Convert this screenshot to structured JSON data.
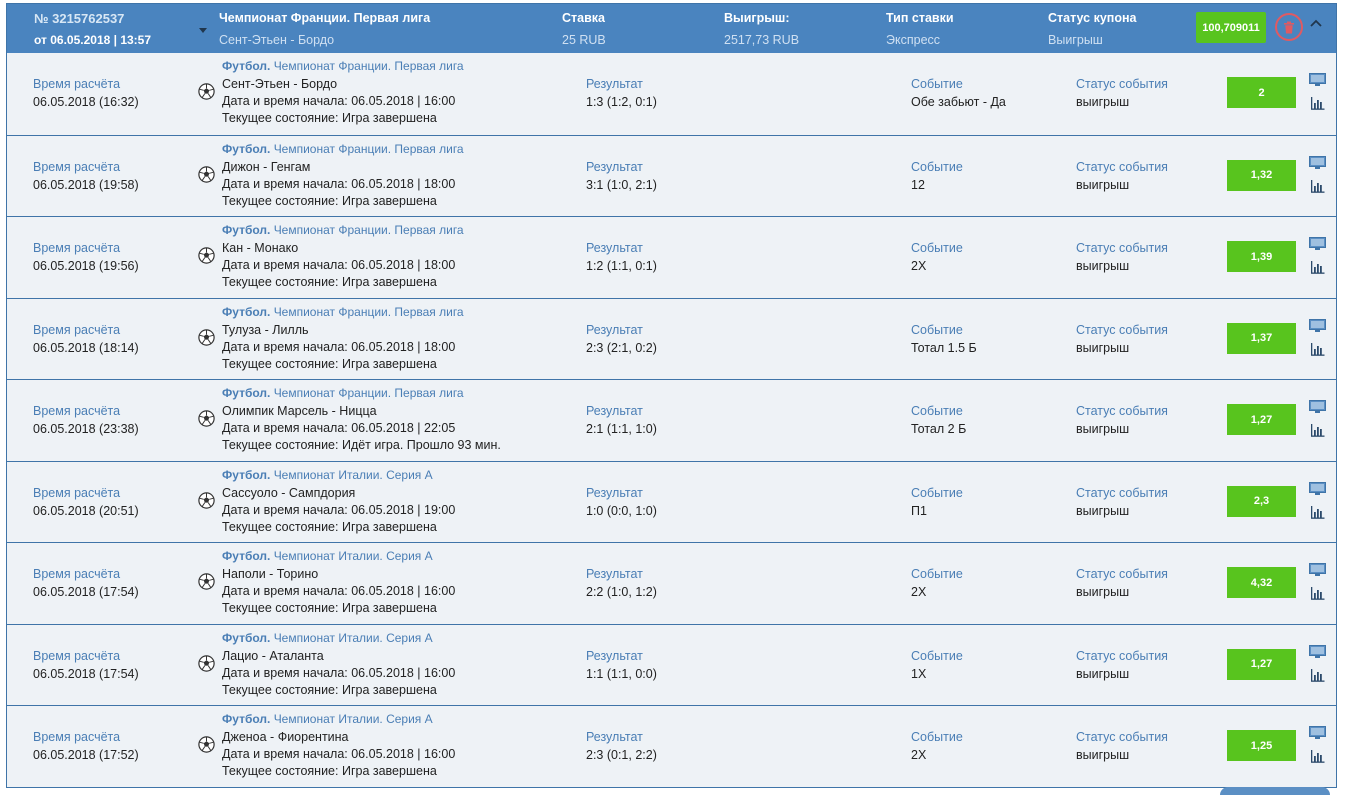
{
  "coupon": {
    "number": "№ 3215762537",
    "date": "от 06.05.2018 | 13:57",
    "championship": "Чемпионат Франции. Первая лига",
    "match": "Сент-Этьен - Бордо",
    "stake_label": "Ставка",
    "stake_value": "25 RUB",
    "win_label": "Выигрыш:",
    "win_value": "2517,73 RUB",
    "type_label": "Тип ставки",
    "type_value": "Экспресс",
    "status_label": "Статус купона",
    "status_value": "Выигрыш",
    "total_coef": "100,709011"
  },
  "labels": {
    "calc_time": "Время расчёта",
    "start_prefix": "Дата и время начала: ",
    "state_prefix": "Текущее состояние: ",
    "result": "Результат",
    "event": "Событие",
    "event_status": "Статус события",
    "sport": "Футбол."
  },
  "colors": {
    "header": "#4a84bf",
    "row_bg": "#eef2f6",
    "odd_green": "#58c41e",
    "accent_blue": "#4a7eb5",
    "trash_red": "#e05a62"
  },
  "rows": [
    {
      "calc": "06.05.2018 (16:32)",
      "league": "Чемпионат Франции. Первая лига",
      "match": "Сент-Этьен - Бордо",
      "start": "06.05.2018 | 16:00",
      "state": "Игра завершена",
      "result": "1:3 (1:2, 0:1)",
      "event": "Обе забьют - Да",
      "status": "выигрыш",
      "odd": "2"
    },
    {
      "calc": "06.05.2018 (19:58)",
      "league": "Чемпионат Франции. Первая лига",
      "match": "Дижон - Генгам",
      "start": "06.05.2018 | 18:00",
      "state": "Игра завершена",
      "result": "3:1 (1:0, 2:1)",
      "event": "12",
      "status": "выигрыш",
      "odd": "1,32"
    },
    {
      "calc": "06.05.2018 (19:56)",
      "league": "Чемпионат Франции. Первая лига",
      "match": "Кан - Монако",
      "start": "06.05.2018 | 18:00",
      "state": "Игра завершена",
      "result": "1:2 (1:1, 0:1)",
      "event": "2X",
      "status": "выигрыш",
      "odd": "1,39"
    },
    {
      "calc": "06.05.2018 (18:14)",
      "league": "Чемпионат Франции. Первая лига",
      "match": "Тулуза - Лилль",
      "start": "06.05.2018 | 18:00",
      "state": "Игра завершена",
      "result": "2:3 (2:1, 0:2)",
      "event": "Тотал 1.5 Б",
      "status": "выигрыш",
      "odd": "1,37"
    },
    {
      "calc": "06.05.2018 (23:38)",
      "league": "Чемпионат Франции. Первая лига",
      "match": "Олимпик Марсель - Ницца",
      "start": "06.05.2018 | 22:05",
      "state": "Идёт игра. Прошло 93 мин.",
      "result": "2:1 (1:1, 1:0)",
      "event": "Тотал 2 Б",
      "status": "выигрыш",
      "odd": "1,27"
    },
    {
      "calc": "06.05.2018 (20:51)",
      "league": "Чемпионат Италии. Серия А",
      "match": "Сассуоло - Сампдория",
      "start": "06.05.2018 | 19:00",
      "state": "Игра завершена",
      "result": "1:0 (0:0, 1:0)",
      "event": "П1",
      "status": "выигрыш",
      "odd": "2,3"
    },
    {
      "calc": "06.05.2018 (17:54)",
      "league": "Чемпионат Италии. Серия А",
      "match": "Наполи - Торино",
      "start": "06.05.2018 | 16:00",
      "state": "Игра завершена",
      "result": "2:2 (1:0, 1:2)",
      "event": "2X",
      "status": "выигрыш",
      "odd": "4,32"
    },
    {
      "calc": "06.05.2018 (17:54)",
      "league": "Чемпионат Италии. Серия А",
      "match": "Лацио - Аталанта",
      "start": "06.05.2018 | 16:00",
      "state": "Игра завершена",
      "result": "1:1 (1:1, 0:0)",
      "event": "1X",
      "status": "выигрыш",
      "odd": "1,27"
    },
    {
      "calc": "06.05.2018 (17:52)",
      "league": "Чемпионат Италии. Серия А",
      "match": "Дженоа - Фиорентина",
      "start": "06.05.2018 | 16:00",
      "state": "Игра завершена",
      "result": "2:3 (0:1, 2:2)",
      "event": "2X",
      "status": "выигрыш",
      "odd": "1,25"
    }
  ]
}
